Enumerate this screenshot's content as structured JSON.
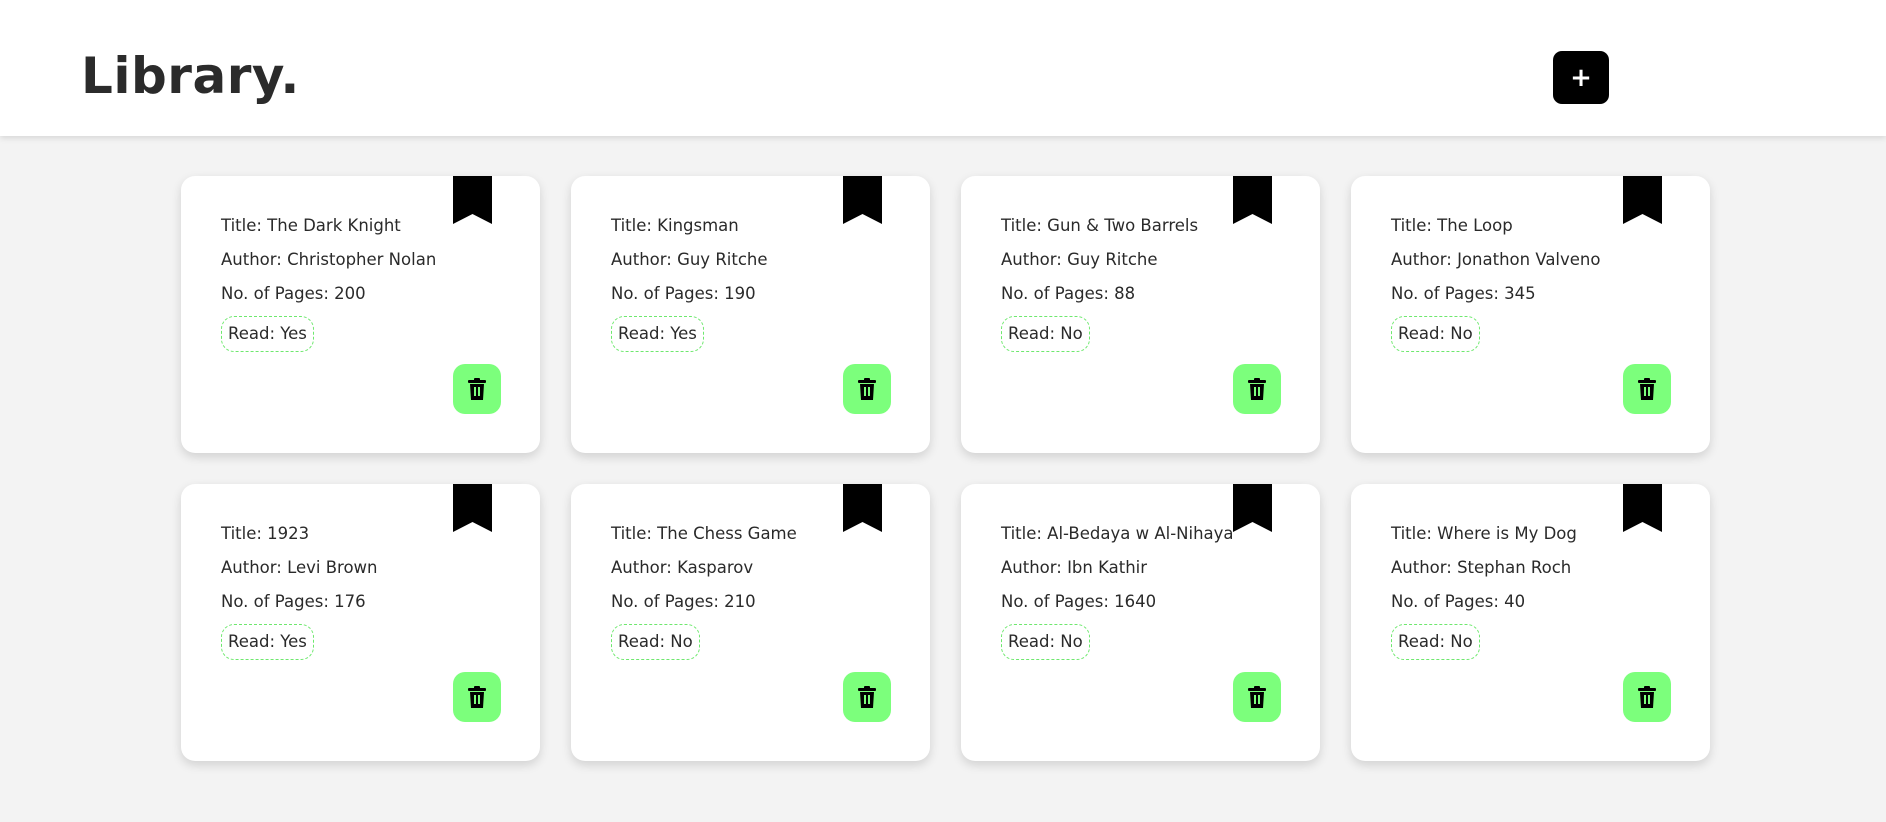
{
  "header": {
    "logo": "Library.",
    "add_label": "+"
  },
  "colors": {
    "accent_green": "#7cff7c",
    "badge_border": "#6ee86e",
    "background": "#f3f3f3"
  },
  "books": [
    {
      "title": "Title: The Dark Knight",
      "author": "Author: Christopher Nolan",
      "pages": "No. of Pages: 200",
      "read": "Read: Yes"
    },
    {
      "title": "Title: Kingsman",
      "author": "Author: Guy Ritche",
      "pages": "No. of Pages: 190",
      "read": "Read: Yes"
    },
    {
      "title": "Title: Gun & Two Barrels",
      "author": "Author: Guy Ritche",
      "pages": "No. of Pages: 88",
      "read": "Read: No"
    },
    {
      "title": "Title: The Loop",
      "author": "Author: Jonathon Valveno",
      "pages": "No. of Pages: 345",
      "read": "Read: No"
    },
    {
      "title": "Title: 1923",
      "author": "Author: Levi Brown",
      "pages": "No. of Pages: 176",
      "read": "Read: Yes"
    },
    {
      "title": "Title: The Chess Game",
      "author": "Author: Kasparov",
      "pages": "No. of Pages: 210",
      "read": "Read: No"
    },
    {
      "title": "Title: Al-Bedaya w Al-Nihaya",
      "author": "Author: Ibn Kathir",
      "pages": "No. of Pages: 1640",
      "read": "Read: No"
    },
    {
      "title": "Title: Where is My Dog",
      "author": "Author: Stephan Roch",
      "pages": "No. of Pages: 40",
      "read": "Read: No"
    }
  ]
}
